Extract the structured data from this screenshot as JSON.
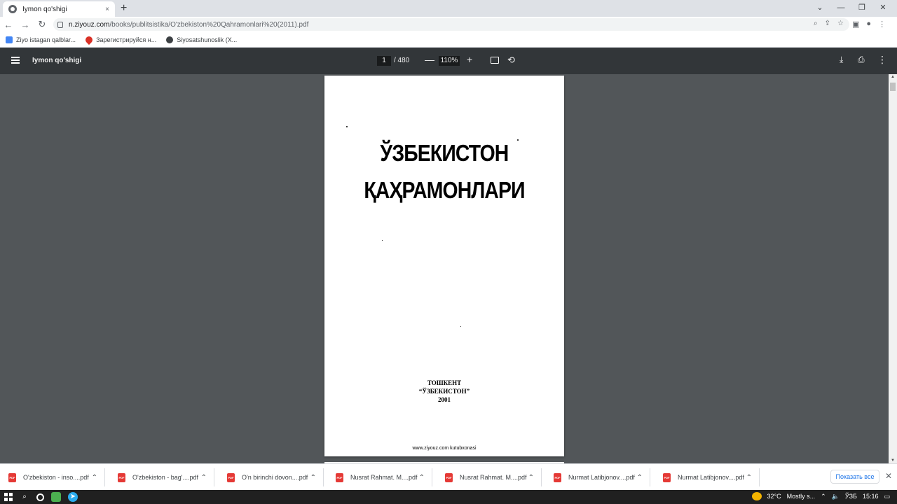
{
  "browser": {
    "tab_title": "Iymon qo'shigi",
    "tab_close": "×",
    "new_tab": "+",
    "window_controls": [
      "⌄",
      "—",
      "❐",
      "✕"
    ],
    "url_domain": "n.ziyouz.com",
    "url_path": "/books/publitsistika/O'zbekiston%20Qahramonlari%20(2011).pdf",
    "nav_back": "←",
    "nav_forward": "→",
    "nav_reload": "↻"
  },
  "bookmarks": [
    {
      "label": "Ziyo istagan qalblar...",
      "color": "#4285f4"
    },
    {
      "label": "Зарегистрируйся н...",
      "color": "#d93025"
    },
    {
      "label": "Siyosatshunoslik (X...",
      "color": "#3c4043"
    }
  ],
  "pdf_toolbar": {
    "title": "Iymon qo'shigi",
    "page_current": "1",
    "page_total": "/ 480",
    "zoom_minus": "—",
    "zoom_level": "110%",
    "zoom_plus": "+",
    "rotate": "⟲",
    "download": "⤓",
    "print": "⎙",
    "more": "⋮"
  },
  "document": {
    "title_line1": "ЎЗБЕКИСТОН",
    "title_line2": "ҚАҲРАМОНЛАРИ",
    "city": "ТОШКЕНТ",
    "publisher": "“ЎЗБЕКИСТОН”",
    "year": "2001",
    "footer": "www.ziyouz.com kutubxonasi"
  },
  "downloads": [
    {
      "name": "O'zbekiston - inso....pdf"
    },
    {
      "name": "O'zbekiston - bag'....pdf"
    },
    {
      "name": "O'n birinchi dovon....pdf"
    },
    {
      "name": "Nusrat Rahmat. M....pdf"
    },
    {
      "name": "Nusrat Rahmat. M....pdf"
    },
    {
      "name": "Nurmat Latibjonov....pdf"
    },
    {
      "name": "Nurmat Latibjonov....pdf"
    }
  ],
  "downloads_show_all": "Показать все",
  "downloads_close": "✕",
  "taskbar": {
    "temperature": "32°C",
    "weather": "Mostly s...",
    "language": "ЎЗБ",
    "time": "15:16"
  }
}
